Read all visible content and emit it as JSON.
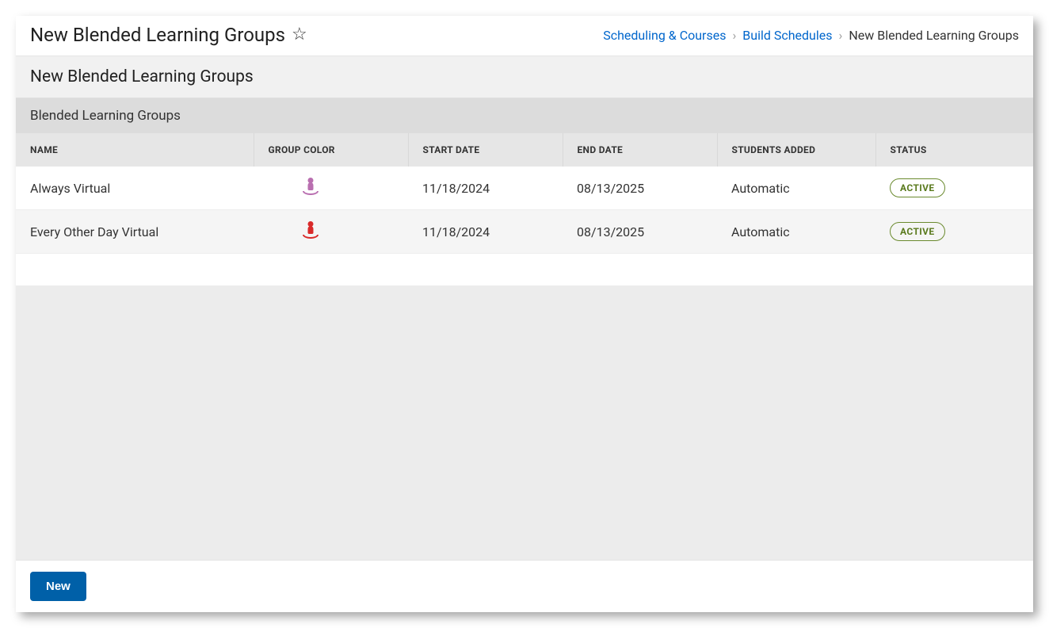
{
  "header": {
    "title": "New Blended Learning Groups"
  },
  "breadcrumb": {
    "link1": "Scheduling & Courses",
    "link2": "Build Schedules",
    "current": "New Blended Learning Groups"
  },
  "subheader": {
    "title": "New Blended Learning Groups"
  },
  "section": {
    "title": "Blended Learning Groups"
  },
  "table": {
    "headers": {
      "name": "NAME",
      "group_color": "GROUP COLOR",
      "start_date": "START DATE",
      "end_date": "END DATE",
      "students_added": "STUDENTS ADDED",
      "status": "STATUS"
    },
    "rows": [
      {
        "name": "Always Virtual",
        "color": "#b96fb0",
        "start_date": "11/18/2024",
        "end_date": "08/13/2025",
        "students_added": "Automatic",
        "status": "ACTIVE"
      },
      {
        "name": "Every Other Day Virtual",
        "color": "#d92a2a",
        "start_date": "11/18/2024",
        "end_date": "08/13/2025",
        "students_added": "Automatic",
        "status": "ACTIVE"
      }
    ]
  },
  "footer": {
    "new_button": "New"
  }
}
